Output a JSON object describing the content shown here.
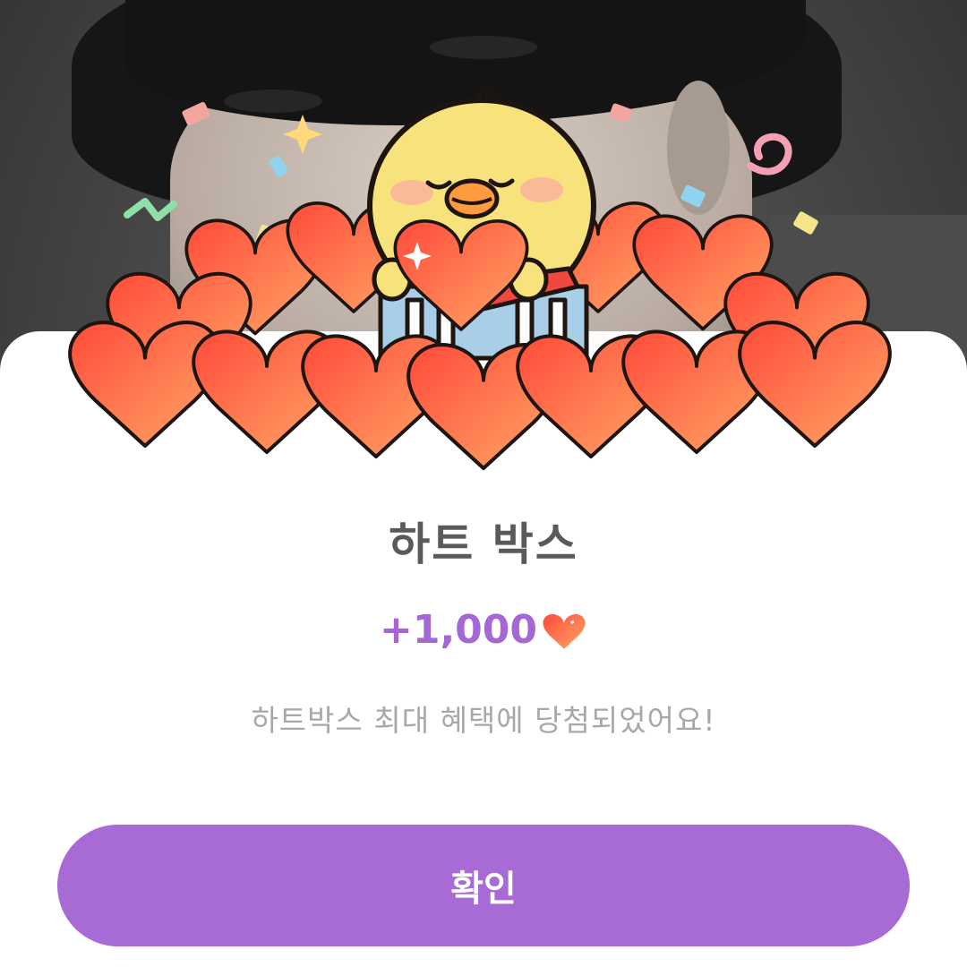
{
  "popup": {
    "title": "하트 박스",
    "reward_amount": "+1,000",
    "message": "하트박스 최대 혜택에 당첨되었어요!",
    "confirm_label": "확인"
  },
  "icons": {
    "reward_currency": "heart-icon",
    "illustration": "chick-with-heart-box"
  },
  "colors": {
    "accent": "#a86ad4",
    "reward_text": "#a368d6",
    "title_text": "#5a5a5a",
    "message_text": "#a8a8a8",
    "heart_red": "#f4593a"
  }
}
